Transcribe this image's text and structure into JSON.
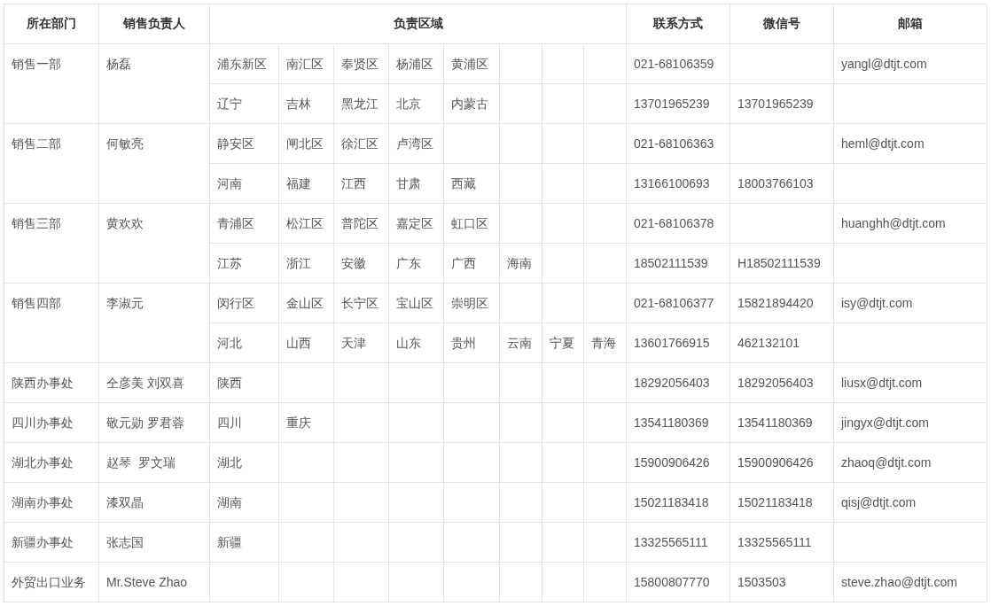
{
  "table": {
    "columns": [
      "所在部门",
      "销售负责人",
      "负责区域",
      "联系方式",
      "微信号",
      "邮箱"
    ],
    "groups": [
      {
        "department": "销售一部",
        "person": "杨磊",
        "rows": [
          {
            "regions": [
              "浦东新区",
              "南汇区",
              "奉贤区",
              "杨浦区",
              "黄浦区"
            ],
            "contact": "021-68106359",
            "wechat": "",
            "email": "yangl@dtjt.com"
          },
          {
            "regions": [
              "辽宁",
              "吉林",
              "黑龙江",
              "北京",
              "内蒙古"
            ],
            "contact": "13701965239",
            "wechat": "13701965239",
            "email": ""
          }
        ]
      },
      {
        "department": "销售二部",
        "person": "何敏亮",
        "rows": [
          {
            "regions": [
              "静安区",
              "闸北区",
              "徐汇区",
              "卢湾区"
            ],
            "contact": "021-68106363",
            "wechat": "",
            "email": "heml@dtjt.com"
          },
          {
            "regions": [
              "河南",
              "福建",
              "江西",
              "甘肃",
              "西藏"
            ],
            "contact": "13166100693",
            "wechat": "18003766103",
            "email": ""
          }
        ]
      },
      {
        "department": "销售三部",
        "person": "黄欢欢",
        "rows": [
          {
            "regions": [
              "青浦区",
              "松江区",
              "普陀区",
              "嘉定区",
              "虹口区"
            ],
            "contact": "021-68106378",
            "wechat": "",
            "email": "huanghh@dtjt.com"
          },
          {
            "regions": [
              "江苏",
              "浙江",
              "安徽",
              "广东",
              "广西",
              "海南"
            ],
            "contact": "18502111539",
            "wechat": "H18502111539",
            "email": ""
          }
        ]
      },
      {
        "department": "销售四部",
        "person": "李淑元",
        "rows": [
          {
            "regions": [
              "闵行区",
              "金山区",
              "长宁区",
              "宝山区",
              "崇明区"
            ],
            "contact": "021-68106377",
            "wechat": "15821894420",
            "email": "isy@dtjt.com"
          },
          {
            "regions": [
              "河北",
              "山西",
              "天津",
              "山东",
              "贵州",
              "云南",
              "宁夏",
              "青海"
            ],
            "contact": "13601766915",
            "wechat": "462132101",
            "email": ""
          }
        ]
      },
      {
        "department": "陕西办事处",
        "person": "仝彦美 刘双喜",
        "rows": [
          {
            "regions": [
              "陕西"
            ],
            "contact": "18292056403",
            "wechat": "18292056403",
            "email": "liusx@dtjt.com"
          }
        ]
      },
      {
        "department": "四川办事处",
        "person": "敬元勋 罗君蓉",
        "rows": [
          {
            "regions": [
              "四川",
              "重庆"
            ],
            "contact": "13541180369",
            "wechat": "13541180369",
            "email": "jingyx@dtjt.com"
          }
        ]
      },
      {
        "department": "湖北办事处",
        "person": "赵琴  罗文瑞",
        "rows": [
          {
            "regions": [
              "湖北"
            ],
            "contact": "15900906426",
            "wechat": "15900906426",
            "email": "zhaoq@dtjt.com"
          }
        ]
      },
      {
        "department": "湖南办事处",
        "person": "漆双晶",
        "rows": [
          {
            "regions": [
              "湖南"
            ],
            "contact": "15021183418",
            "wechat": "15021183418",
            "email": "qisj@dtjt.com"
          }
        ]
      },
      {
        "department": "新疆办事处",
        "person": "张志国",
        "rows": [
          {
            "regions": [
              "新疆"
            ],
            "contact": "13325565111",
            "wechat": "13325565111",
            "email": ""
          }
        ]
      },
      {
        "department": "外贸出口业务",
        "person": "Mr.Steve Zhao",
        "rows": [
          {
            "regions": [],
            "contact": "15800807770",
            "wechat": "1503503",
            "email": "steve.zhao@dtjt.com"
          }
        ]
      }
    ]
  }
}
